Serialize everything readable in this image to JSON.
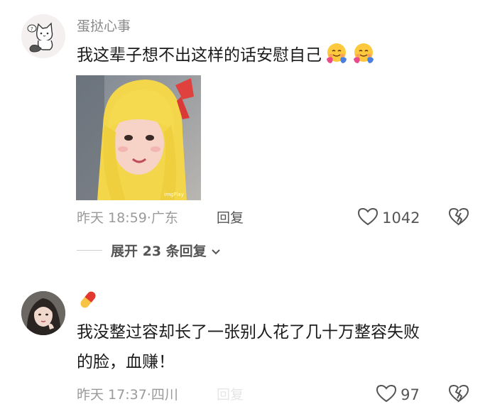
{
  "comments": [
    {
      "username": "蛋挞心事",
      "text": "我这辈子想不出这样的话安慰自己",
      "emojis": [
        "hugging-face-icon",
        "hugging-face-icon"
      ],
      "time": "昨天 18:59",
      "separator": "·",
      "location": "广东",
      "reply_label": "回复",
      "like_count": "1042",
      "expand_label": "展开 23 条回复"
    },
    {
      "username": "",
      "username_badge": "pill-icon",
      "text_line1": "我没整过容却长了一张别人花了几十万整容失败",
      "text_line2": "的脸，血赚！",
      "time": "昨天 17:37",
      "separator": "·",
      "location": "四川",
      "reply_label": "回复",
      "like_count": "97"
    }
  ],
  "colors": {
    "meta_gray": "#9a9a9a",
    "text_dark": "#1b1b1b",
    "pill_red": "#e2382f",
    "pill_yellow": "#f6c344"
  }
}
